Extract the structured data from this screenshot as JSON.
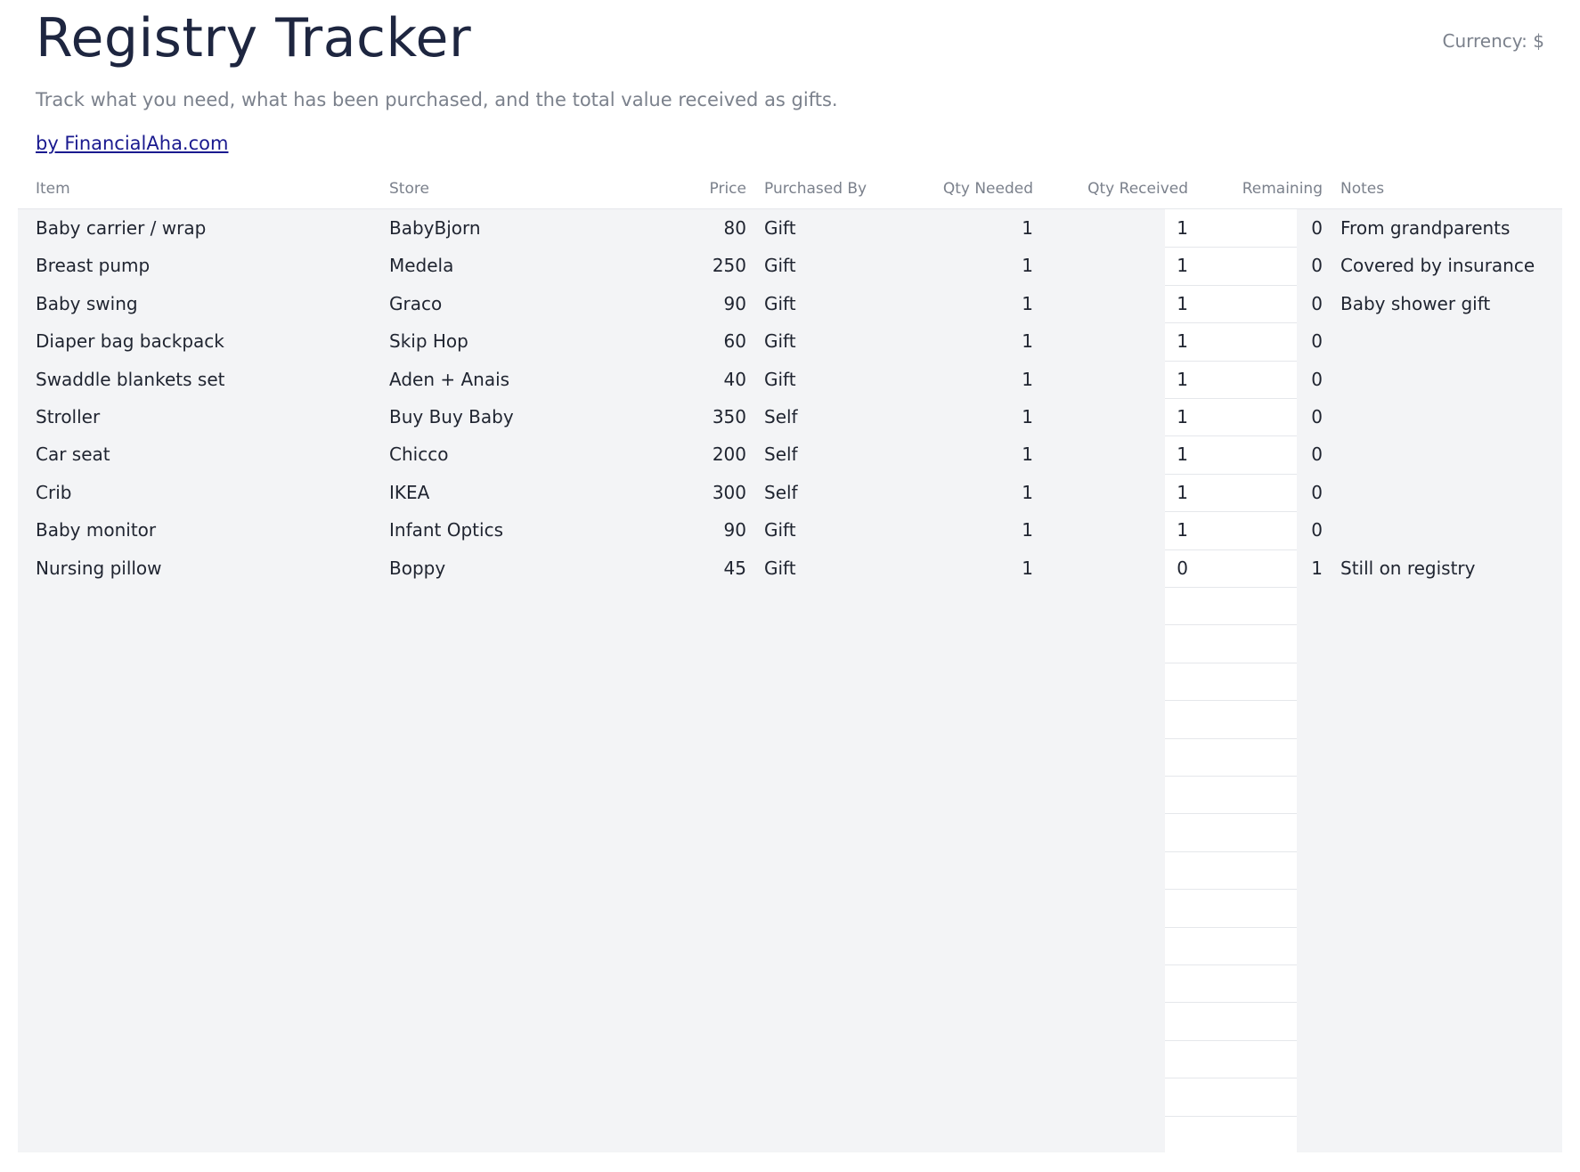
{
  "page": {
    "title": "Registry Tracker",
    "currency_label": "Currency: $",
    "subtitle": "Track what you need, what has been purchased, and the total value received as gifts.",
    "byline": "by FinancialAha.com"
  },
  "table": {
    "columns": [
      "Item",
      "Store",
      "Price",
      "Purchased By",
      "Qty Needed",
      "Qty Received",
      "Remaining",
      "Notes"
    ],
    "rows": [
      {
        "item": "Baby carrier / wrap",
        "store": "BabyBjorn",
        "price": "80",
        "purchased_by": "Gift",
        "qty_needed": "1",
        "qty_received": "1",
        "remaining": "0",
        "notes": "From grandparents"
      },
      {
        "item": "Breast pump",
        "store": "Medela",
        "price": "250",
        "purchased_by": "Gift",
        "qty_needed": "1",
        "qty_received": "1",
        "remaining": "0",
        "notes": "Covered by insurance"
      },
      {
        "item": "Baby swing",
        "store": "Graco",
        "price": "90",
        "purchased_by": "Gift",
        "qty_needed": "1",
        "qty_received": "1",
        "remaining": "0",
        "notes": "Baby shower gift"
      },
      {
        "item": "Diaper bag backpack",
        "store": "Skip Hop",
        "price": "60",
        "purchased_by": "Gift",
        "qty_needed": "1",
        "qty_received": "1",
        "remaining": "0",
        "notes": ""
      },
      {
        "item": "Swaddle blankets set",
        "store": "Aden + Anais",
        "price": "40",
        "purchased_by": "Gift",
        "qty_needed": "1",
        "qty_received": "1",
        "remaining": "0",
        "notes": ""
      },
      {
        "item": "Stroller",
        "store": "Buy Buy Baby",
        "price": "350",
        "purchased_by": "Self",
        "qty_needed": "1",
        "qty_received": "1",
        "remaining": "0",
        "notes": ""
      },
      {
        "item": "Car seat",
        "store": "Chicco",
        "price": "200",
        "purchased_by": "Self",
        "qty_needed": "1",
        "qty_received": "1",
        "remaining": "0",
        "notes": ""
      },
      {
        "item": "Crib",
        "store": "IKEA",
        "price": "300",
        "purchased_by": "Self",
        "qty_needed": "1",
        "qty_received": "1",
        "remaining": "0",
        "notes": ""
      },
      {
        "item": "Baby monitor",
        "store": "Infant Optics",
        "price": "90",
        "purchased_by": "Gift",
        "qty_needed": "1",
        "qty_received": "1",
        "remaining": "0",
        "notes": ""
      },
      {
        "item": "Nursing pillow",
        "store": "Boppy",
        "price": "45",
        "purchased_by": "Gift",
        "qty_needed": "1",
        "qty_received": "0",
        "remaining": "1",
        "notes": "Still on registry"
      }
    ]
  }
}
